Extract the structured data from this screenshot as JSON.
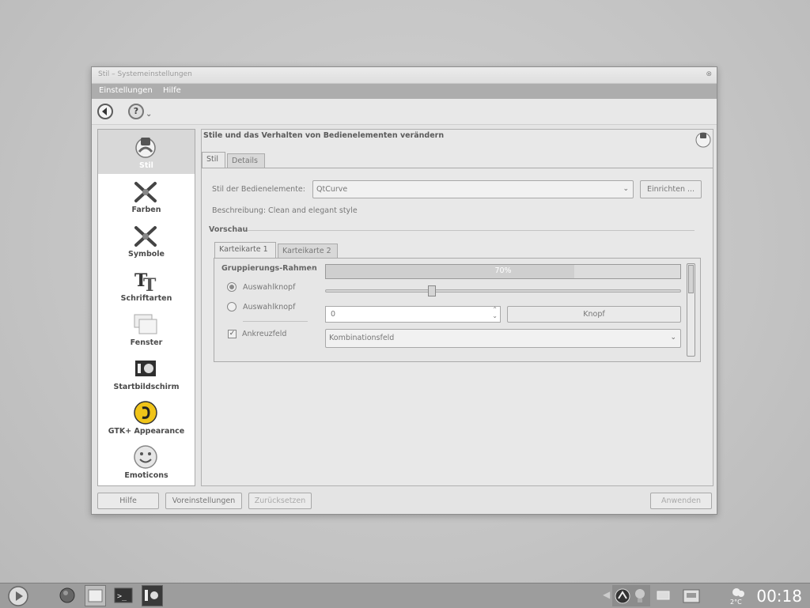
{
  "window": {
    "title": "Stil – Systemeinstellungen",
    "close_glyph": "⊗"
  },
  "menubar": {
    "items": [
      {
        "label": "Einstellungen"
      },
      {
        "label": "Hilfe"
      }
    ]
  },
  "toolbar": {
    "back_icon": "back-arrow-icon",
    "help_icon": "help-icon",
    "help_dropdown": "⌄"
  },
  "sidebar": {
    "items": [
      {
        "label": "Stil",
        "icon": "style-icon",
        "active": true
      },
      {
        "label": "Farben",
        "icon": "colors-icon"
      },
      {
        "label": "Symbole",
        "icon": "icons-icon"
      },
      {
        "label": "Schriftarten",
        "icon": "fonts-icon"
      },
      {
        "label": "Fenster",
        "icon": "windows-icon"
      },
      {
        "label": "Startbildschirm",
        "icon": "splash-icon"
      },
      {
        "label": "GTK+ Appearance",
        "icon": "gtk-icon"
      },
      {
        "label": "Emoticons",
        "icon": "emoticons-icon"
      }
    ]
  },
  "main": {
    "heading": "Stile und das Verhalten von Bedienelementen verändern",
    "tabs": [
      {
        "label": "Stil",
        "selected": true
      },
      {
        "label": "Details"
      }
    ],
    "widget_style_label": "Stil der Bedienelemente:",
    "widget_style_value": "QtCurve",
    "configure_button": "Einrichten ...",
    "description": "Beschreibung: Clean and elegant style",
    "preview_label": "Vorschau",
    "preview": {
      "tabs": [
        {
          "label": "Karteikarte 1",
          "selected": true
        },
        {
          "label": "Karteikarte 2"
        }
      ],
      "group_label": "Gruppierungs-Rahmen",
      "radio1_label": "Auswahlknopf",
      "radio2_label": "Auswahlknopf",
      "checkbox_label": "Ankreuzfeld",
      "progress_text": "70%",
      "progress_value": 0.7,
      "slider_value": 0.3,
      "spin_value": "0",
      "button_label": "Knopf",
      "combo_label": "Kombinationsfeld"
    }
  },
  "bottom_buttons": {
    "help": "Hilfe",
    "defaults": "Voreinstellungen",
    "reset": "Zurücksetzen",
    "apply": "Anwenden"
  },
  "panel": {
    "clock": "00:18",
    "weather_temp": "2°C"
  }
}
